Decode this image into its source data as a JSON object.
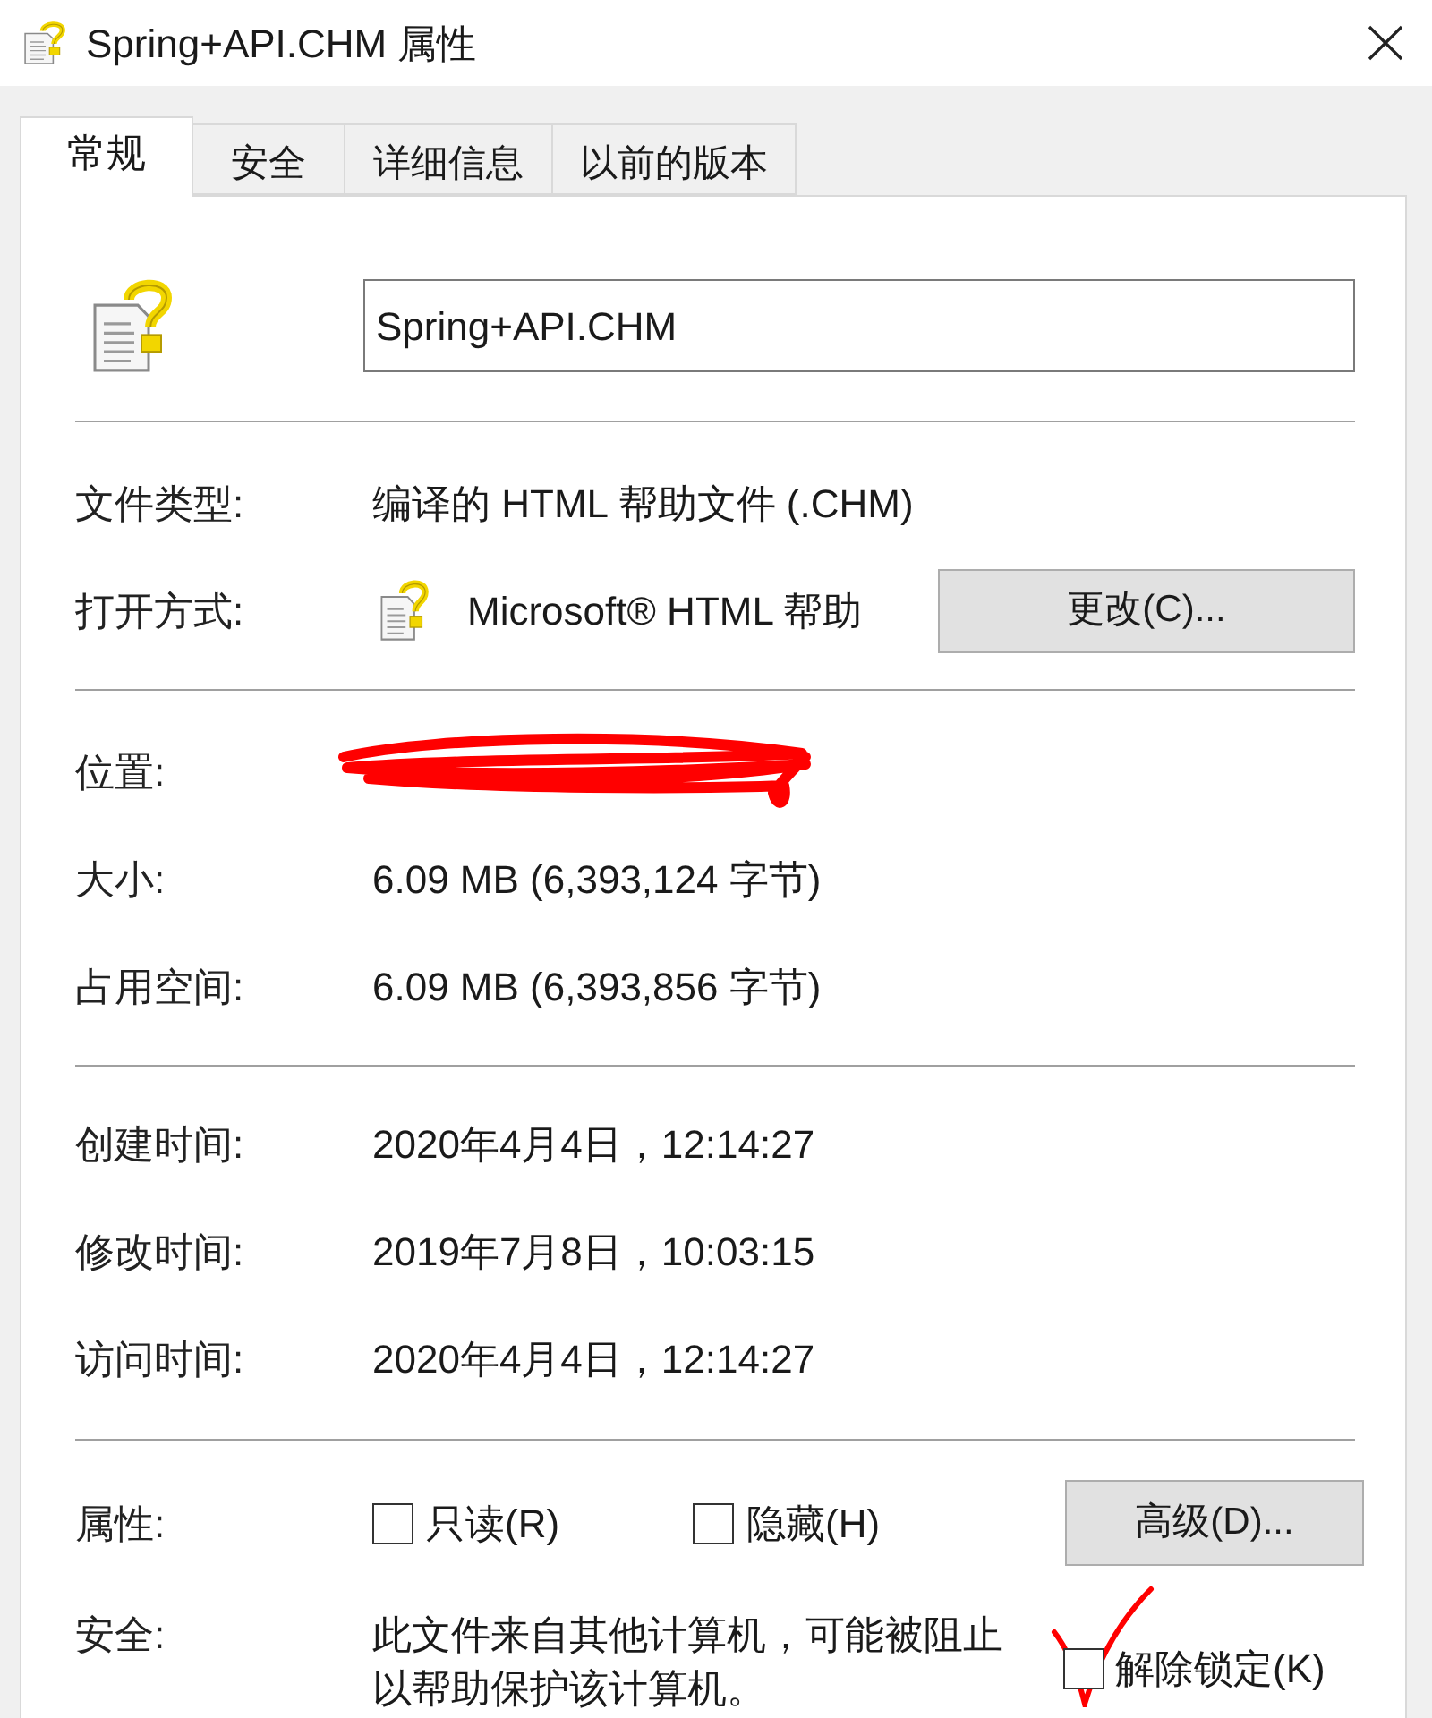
{
  "window": {
    "title": "Spring+API.CHM 属性"
  },
  "tabs": [
    {
      "label": "常规",
      "selected": true
    },
    {
      "label": "安全",
      "selected": false
    },
    {
      "label": "详细信息",
      "selected": false
    },
    {
      "label": "以前的版本",
      "selected": false
    }
  ],
  "file_name": "Spring+API.CHM",
  "file_type": {
    "label": "文件类型:",
    "value": "编译的 HTML 帮助文件 (.CHM)"
  },
  "opens_with": {
    "label": "打开方式:",
    "value": "Microsoft® HTML 帮助",
    "button": "更改(C)..."
  },
  "location": {
    "label": "位置:",
    "redacted": true
  },
  "sizes": [
    {
      "label": "大小:",
      "value": "6.09 MB (6,393,124 字节)"
    },
    {
      "label": "占用空间:",
      "value": "6.09 MB (6,393,856 字节)"
    }
  ],
  "times": [
    {
      "label": "创建时间:",
      "value": "2020年4月4日，12:14:27"
    },
    {
      "label": "修改时间:",
      "value": "2019年7月8日，10:03:15"
    },
    {
      "label": "访问时间:",
      "value": "2020年4月4日，12:14:27"
    }
  ],
  "attributes": {
    "label": "属性:",
    "checkboxes": [
      {
        "label": "只读(R)",
        "checked": false
      },
      {
        "label": "隐藏(H)",
        "checked": false
      }
    ],
    "button": "高级(D)..."
  },
  "security": {
    "label": "安全:",
    "text": "此文件来自其他计算机，可能被阻止以帮助保护该计算机。",
    "unblock": {
      "label": "解除锁定(K)",
      "checked": false,
      "annotated": true
    }
  }
}
